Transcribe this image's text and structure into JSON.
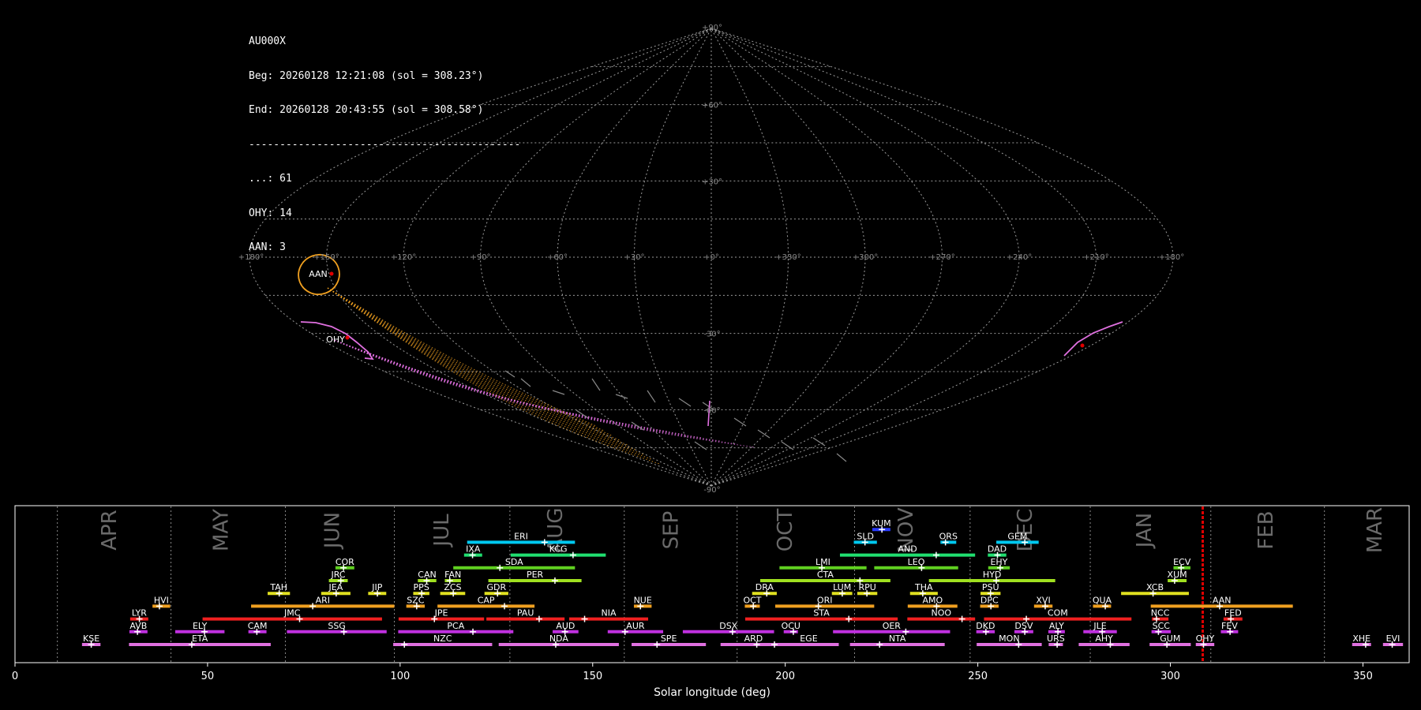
{
  "info": {
    "station": "AU000X",
    "beg": "Beg: 20260128 12:21:08 (sol = 308.23°)",
    "end": "End: 20260128 20:43:55 (sol = 308.58°)",
    "separator": "--------------------------------------------",
    "counts": [
      "...: 61",
      "OHY: 14",
      "AAN: 3"
    ]
  },
  "colors": {
    "background": "#000000",
    "grid": "#9a9a9a",
    "aan": "#f0a020",
    "ohy": "#e070e0",
    "current": "#e00000"
  },
  "chart_data": [
    {
      "type": "scatter",
      "projection": "sinusoidal",
      "lon_ticks": [
        "+180°",
        "+150°",
        "+120°",
        "+90°",
        "+60°",
        "+30°",
        "+0°",
        "+330°",
        "+300°",
        "+270°",
        "+240°",
        "+210°",
        "+180°"
      ],
      "lat_ticks": [
        "+90°",
        "+60°",
        "+30°",
        "-30°",
        "-60°",
        "-90°"
      ],
      "grid": true,
      "labels": [
        {
          "name": "AAN",
          "lon": 154,
          "lat": -12
        },
        {
          "name": "OHY",
          "lon": 142,
          "lat": -60
        }
      ]
    },
    {
      "type": "bar",
      "xlabel": "Solar longitude (deg)",
      "xlim": [
        0,
        362
      ],
      "x_ticks": [
        0,
        50,
        100,
        150,
        200,
        250,
        300,
        350
      ],
      "month_boundaries": [
        11,
        40.5,
        70.2,
        98.5,
        128.5,
        158.2,
        187.5,
        218,
        248,
        279.2,
        310.5,
        340
      ],
      "months": [
        {
          "label": "APR",
          "x": 24.7
        },
        {
          "label": "MAY",
          "x": 53.7
        },
        {
          "label": "JUN",
          "x": 82.6
        },
        {
          "label": "JUL",
          "x": 111
        },
        {
          "label": "AUG",
          "x": 140.5
        },
        {
          "label": "SEP",
          "x": 170.5
        },
        {
          "label": "OCT",
          "x": 200.2
        },
        {
          "label": "NOV",
          "x": 231.5
        },
        {
          "label": "DEC",
          "x": 262.5
        },
        {
          "label": "JAN",
          "x": 293.4
        },
        {
          "label": "FEB",
          "x": 325
        },
        {
          "label": "MAR",
          "x": 353.3
        }
      ],
      "current_sol": 308.4,
      "showers": [
        {
          "name": "KUM",
          "start": 222.6,
          "end": 227.3,
          "peak": 225.1,
          "row": 9,
          "color": "#2a3cff"
        },
        {
          "name": "ERI",
          "start": 117.4,
          "end": 145.4,
          "peak": 137.5,
          "row": 8,
          "color": "#00c8f0"
        },
        {
          "name": "SLD",
          "start": 217.8,
          "end": 223.8,
          "peak": 220.7,
          "row": 8,
          "color": "#00c8f0"
        },
        {
          "name": "ORS",
          "start": 240.3,
          "end": 244.4,
          "peak": 241.6,
          "row": 8,
          "color": "#00c8f0"
        },
        {
          "name": "GEM",
          "start": 254.8,
          "end": 265.8,
          "peak": 262.2,
          "row": 8,
          "color": "#00c8f0"
        },
        {
          "name": "IXA",
          "start": 116.6,
          "end": 121.3,
          "peak": 118.8,
          "row": 7,
          "color": "#20e070"
        },
        {
          "name": "KCG",
          "start": 128.7,
          "end": 153.4,
          "peak": 144.9,
          "row": 7,
          "color": "#20e070"
        },
        {
          "name": "AND",
          "start": 214.2,
          "end": 249.3,
          "peak": 239.2,
          "row": 7,
          "color": "#20e070"
        },
        {
          "name": "DAD",
          "start": 252.6,
          "end": 257.4,
          "peak": 255.1,
          "row": 7,
          "color": "#20e070"
        },
        {
          "name": "COR",
          "start": 83.2,
          "end": 88.1,
          "peak": 85.3,
          "row": 6,
          "color": "#60d020"
        },
        {
          "name": "SDA",
          "start": 113.8,
          "end": 145.4,
          "peak": 125.9,
          "row": 6,
          "color": "#60d020"
        },
        {
          "name": "LMI",
          "start": 198.5,
          "end": 221.1,
          "peak": 209.5,
          "row": 6,
          "color": "#60d020"
        },
        {
          "name": "LEO",
          "start": 223.1,
          "end": 244.9,
          "peak": 235.4,
          "row": 6,
          "color": "#60d020"
        },
        {
          "name": "EHY",
          "start": 252.7,
          "end": 258.3,
          "peak": 255.8,
          "row": 6,
          "color": "#60d020"
        },
        {
          "name": "ECV",
          "start": 300.8,
          "end": 305.2,
          "peak": 302.8,
          "row": 6,
          "color": "#60d020"
        },
        {
          "name": "JRC",
          "start": 81.5,
          "end": 86.4,
          "peak": 84.6,
          "row": 5,
          "color": "#a0e020"
        },
        {
          "name": "CAN",
          "start": 104.6,
          "end": 109.4,
          "peak": 106.9,
          "row": 5,
          "color": "#a0e020"
        },
        {
          "name": "FAN",
          "start": 111.6,
          "end": 115.8,
          "peak": 112.9,
          "row": 5,
          "color": "#a0e020"
        },
        {
          "name": "PER",
          "start": 122.9,
          "end": 147.1,
          "peak": 140.2,
          "row": 5,
          "color": "#a0e020"
        },
        {
          "name": "CTA",
          "start": 193.5,
          "end": 227.3,
          "peak": 219.4,
          "row": 5,
          "color": "#a0e020"
        },
        {
          "name": "HYD",
          "start": 237.3,
          "end": 270.1,
          "peak": 254.8,
          "row": 5,
          "color": "#a0e020"
        },
        {
          "name": "XUM",
          "start": 299.3,
          "end": 304.2,
          "peak": 301.1,
          "row": 5,
          "color": "#a0e020"
        },
        {
          "name": "TAH",
          "start": 65.6,
          "end": 71.4,
          "peak": 68.6,
          "row": 4,
          "color": "#e0e020"
        },
        {
          "name": "JEA",
          "start": 79.5,
          "end": 87.1,
          "peak": 83.4,
          "row": 4,
          "color": "#e0e020"
        },
        {
          "name": "JIP",
          "start": 91.7,
          "end": 96.4,
          "peak": 94.1,
          "row": 4,
          "color": "#e0e020"
        },
        {
          "name": "PPS",
          "start": 103.4,
          "end": 107.6,
          "peak": 105.6,
          "row": 4,
          "color": "#e0e020"
        },
        {
          "name": "ZCS",
          "start": 110.4,
          "end": 116.9,
          "peak": 113.8,
          "row": 4,
          "color": "#e0e020"
        },
        {
          "name": "GDR",
          "start": 121.9,
          "end": 128.1,
          "peak": 125.3,
          "row": 4,
          "color": "#e0e020"
        },
        {
          "name": "DRA",
          "start": 191.4,
          "end": 197.8,
          "peak": 195.2,
          "row": 4,
          "color": "#e0e020"
        },
        {
          "name": "LUM",
          "start": 212.1,
          "end": 217.4,
          "peak": 214.8,
          "row": 4,
          "color": "#e0e020"
        },
        {
          "name": "RPU",
          "start": 218.7,
          "end": 223.9,
          "peak": 221.2,
          "row": 4,
          "color": "#e0e020"
        },
        {
          "name": "THA",
          "start": 232.4,
          "end": 239.6,
          "peak": 235.7,
          "row": 4,
          "color": "#e0e020"
        },
        {
          "name": "PSU",
          "start": 250.7,
          "end": 255.9,
          "peak": 253.3,
          "row": 4,
          "color": "#e0e020"
        },
        {
          "name": "XCB",
          "start": 287.2,
          "end": 304.8,
          "peak": 295.5,
          "row": 4,
          "color": "#e0e020"
        },
        {
          "name": "HVI",
          "start": 35.7,
          "end": 40.3,
          "peak": 37.5,
          "row": 3,
          "color": "#f0a020"
        },
        {
          "name": "ARI",
          "start": 61.3,
          "end": 98.5,
          "peak": 77.3,
          "row": 3,
          "color": "#f0a020"
        },
        {
          "name": "SZC",
          "start": 101.6,
          "end": 106.4,
          "peak": 104.3,
          "row": 3,
          "color": "#f0a020"
        },
        {
          "name": "CAP",
          "start": 109.7,
          "end": 134.9,
          "peak": 127.1,
          "row": 3,
          "color": "#f0a020"
        },
        {
          "name": "NUE",
          "start": 160.7,
          "end": 165.3,
          "peak": 162.4,
          "row": 3,
          "color": "#f0a020"
        },
        {
          "name": "OCT",
          "start": 189.5,
          "end": 193.4,
          "peak": 191.7,
          "row": 3,
          "color": "#f0a020"
        },
        {
          "name": "ORI",
          "start": 197.4,
          "end": 223.1,
          "peak": 208.6,
          "row": 3,
          "color": "#f0a020"
        },
        {
          "name": "AMO",
          "start": 231.8,
          "end": 244.7,
          "peak": 239.3,
          "row": 3,
          "color": "#f0a020"
        },
        {
          "name": "DPC",
          "start": 250.6,
          "end": 255.4,
          "peak": 253.4,
          "row": 3,
          "color": "#f0a020"
        },
        {
          "name": "XVI",
          "start": 264.6,
          "end": 269.4,
          "peak": 267.5,
          "row": 3,
          "color": "#f0a020"
        },
        {
          "name": "QUA",
          "start": 279.9,
          "end": 284.6,
          "peak": 283.1,
          "row": 3,
          "color": "#f0a020"
        },
        {
          "name": "AAN",
          "start": 294.9,
          "end": 331.8,
          "peak": 312.8,
          "row": 3,
          "color": "#f0a020"
        },
        {
          "name": "LYR",
          "start": 29.9,
          "end": 34.6,
          "peak": 32.3,
          "row": 2,
          "color": "#f02020"
        },
        {
          "name": "JMC",
          "start": 48.7,
          "end": 95.3,
          "peak": 73.9,
          "row": 2,
          "color": "#f02020"
        },
        {
          "name": "JPE",
          "start": 99.6,
          "end": 121.8,
          "peak": 108.9,
          "row": 2,
          "color": "#f02020"
        },
        {
          "name": "PAU",
          "start": 122.4,
          "end": 142.7,
          "peak": 136.1,
          "row": 2,
          "color": "#f02020"
        },
        {
          "name": "NIA",
          "start": 143.9,
          "end": 164.4,
          "peak": 147.9,
          "row": 2,
          "color": "#f02020"
        },
        {
          "name": "STA",
          "start": 189.6,
          "end": 229.2,
          "peak": 216.5,
          "row": 2,
          "color": "#f02020"
        },
        {
          "name": "NOO",
          "start": 231.7,
          "end": 249.3,
          "peak": 245.9,
          "row": 2,
          "color": "#f02020"
        },
        {
          "name": "COM",
          "start": 251.6,
          "end": 289.9,
          "peak": 262.6,
          "row": 2,
          "color": "#f02020"
        },
        {
          "name": "NCC",
          "start": 295.2,
          "end": 299.5,
          "peak": 296.4,
          "row": 2,
          "color": "#f02020"
        },
        {
          "name": "FED",
          "start": 313.8,
          "end": 318.7,
          "peak": 315.7,
          "row": 2,
          "color": "#f02020"
        },
        {
          "name": "AVB",
          "start": 29.7,
          "end": 34.4,
          "peak": 31.8,
          "row": 1,
          "color": "#c030e0"
        },
        {
          "name": "ELY",
          "start": 41.6,
          "end": 54.4,
          "peak": 49.2,
          "row": 1,
          "color": "#c030e0"
        },
        {
          "name": "CAM",
          "start": 60.6,
          "end": 65.3,
          "peak": 62.8,
          "row": 1,
          "color": "#c030e0"
        },
        {
          "name": "SSG",
          "start": 70.6,
          "end": 96.5,
          "peak": 85.4,
          "row": 1,
          "color": "#c030e0"
        },
        {
          "name": "PCA",
          "start": 99.5,
          "end": 129.4,
          "peak": 118.9,
          "row": 1,
          "color": "#c030e0"
        },
        {
          "name": "AUD",
          "start": 139.6,
          "end": 146.3,
          "peak": 142.8,
          "row": 1,
          "color": "#c030e0"
        },
        {
          "name": "AUR",
          "start": 153.9,
          "end": 168.3,
          "peak": 158.4,
          "row": 1,
          "color": "#c030e0"
        },
        {
          "name": "DSX",
          "start": 173.4,
          "end": 197.1,
          "peak": 186.3,
          "row": 1,
          "color": "#c030e0"
        },
        {
          "name": "OCU",
          "start": 199.6,
          "end": 203.3,
          "peak": 202.1,
          "row": 1,
          "color": "#c030e0"
        },
        {
          "name": "OER",
          "start": 212.4,
          "end": 242.8,
          "peak": 231.3,
          "row": 1,
          "color": "#c030e0"
        },
        {
          "name": "DKD",
          "start": 249.6,
          "end": 254.4,
          "peak": 252.1,
          "row": 1,
          "color": "#c030e0"
        },
        {
          "name": "DSV",
          "start": 259.5,
          "end": 264.4,
          "peak": 262.2,
          "row": 1,
          "color": "#c030e0"
        },
        {
          "name": "ALY",
          "start": 268.3,
          "end": 272.6,
          "peak": 270.8,
          "row": 1,
          "color": "#c030e0"
        },
        {
          "name": "JLE",
          "start": 277.4,
          "end": 286.1,
          "peak": 282.3,
          "row": 1,
          "color": "#c030e0"
        },
        {
          "name": "SCC",
          "start": 295.1,
          "end": 300.1,
          "peak": 296.9,
          "row": 1,
          "color": "#c030e0"
        },
        {
          "name": "FEV",
          "start": 313.1,
          "end": 317.6,
          "peak": 315.5,
          "row": 1,
          "color": "#c030e0"
        },
        {
          "name": "KSE",
          "start": 17.4,
          "end": 22.2,
          "peak": 19.8,
          "row": 0,
          "color": "#e070e0"
        },
        {
          "name": "ETA",
          "start": 29.6,
          "end": 66.4,
          "peak": 45.9,
          "row": 0,
          "color": "#e070e0"
        },
        {
          "name": "NZC",
          "start": 98.2,
          "end": 123.9,
          "peak": 101.1,
          "row": 0,
          "color": "#e070e0"
        },
        {
          "name": "NDA",
          "start": 125.6,
          "end": 156.8,
          "peak": 140.4,
          "row": 0,
          "color": "#e070e0"
        },
        {
          "name": "SPE",
          "start": 160.1,
          "end": 179.4,
          "peak": 166.7,
          "row": 0,
          "color": "#e070e0"
        },
        {
          "name": "ARD",
          "start": 183.2,
          "end": 200.3,
          "peak": 192.6,
          "row": 0,
          "color": "#e070e0"
        },
        {
          "name": "EGE",
          "start": 198.3,
          "end": 213.9,
          "peak": 197.2,
          "row": 0,
          "color": "#e070e0"
        },
        {
          "name": "NTA",
          "start": 216.8,
          "end": 241.4,
          "peak": 224.5,
          "row": 0,
          "color": "#e070e0"
        },
        {
          "name": "MON",
          "start": 249.7,
          "end": 266.6,
          "peak": 260.6,
          "row": 0,
          "color": "#e070e0"
        },
        {
          "name": "URS",
          "start": 268.4,
          "end": 272.1,
          "peak": 270.6,
          "row": 0,
          "color": "#e070e0"
        },
        {
          "name": "AHY",
          "start": 276.2,
          "end": 289.4,
          "peak": 284.4,
          "row": 0,
          "color": "#e070e0"
        },
        {
          "name": "GUM",
          "start": 294.6,
          "end": 305.3,
          "peak": 299.1,
          "row": 0,
          "color": "#e070e0"
        },
        {
          "name": "OHY",
          "start": 306.6,
          "end": 311.4,
          "peak": 308.6,
          "row": 0,
          "color": "#e070e0"
        },
        {
          "name": "XHE",
          "start": 347.2,
          "end": 352.1,
          "peak": 350.7,
          "row": 0,
          "color": "#e070e0"
        },
        {
          "name": "EVI",
          "start": 355.2,
          "end": 360.4,
          "peak": 357.6,
          "row": 0,
          "color": "#e070e0"
        }
      ]
    }
  ]
}
